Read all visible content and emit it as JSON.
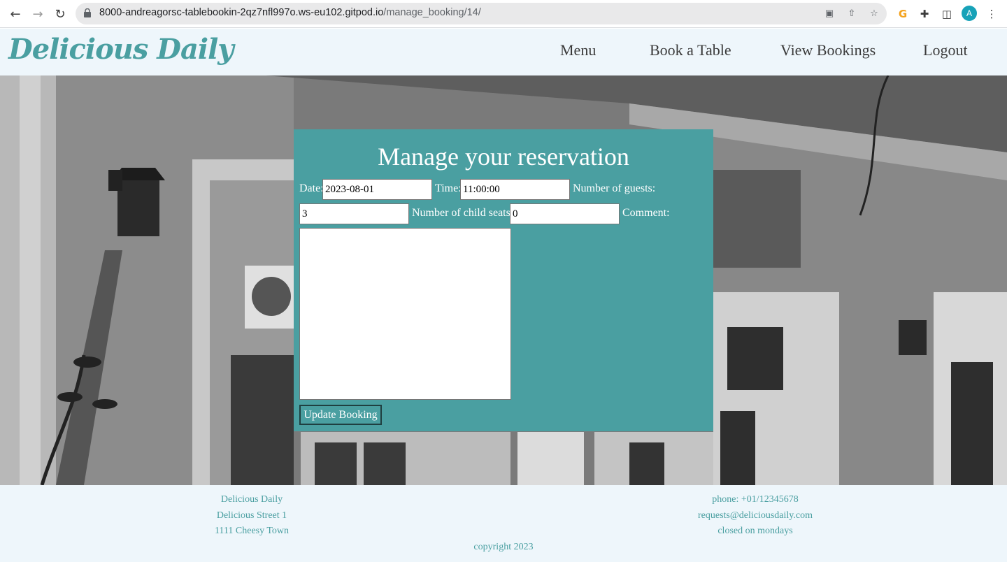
{
  "browser": {
    "url_host": "8000-andreagorsc-tablebookin-2qz7nfl997o.ws-eu102.gitpod.io",
    "url_path": "/manage_booking/14/",
    "profile_initial": "A"
  },
  "header": {
    "brand": "Delicious Daily",
    "nav": [
      "Menu",
      "Book a Table",
      "View Bookings",
      "Logout"
    ]
  },
  "form": {
    "title": "Manage your reservation",
    "date_label": "Date:",
    "date_value": "2023-08-01",
    "time_label": "Time:",
    "time_value": "11:00:00",
    "guests_label": "Number of guests:",
    "guests_value": "3",
    "child_label": "Number of child seats:",
    "child_value": "0",
    "comment_label": "Comment:",
    "comment_value": "",
    "submit_label": "Update Booking"
  },
  "footer": {
    "address": [
      "Delicious Daily",
      "Delicious Street 1",
      "1111 Cheesy Town"
    ],
    "contact": [
      "phone: +01/12345678",
      "requests@deliciousdaily.com",
      "closed on mondays"
    ],
    "copyright": "copyright 2023"
  },
  "colors": {
    "accent": "#4a9fa1",
    "header_bg": "#eef6fb"
  }
}
